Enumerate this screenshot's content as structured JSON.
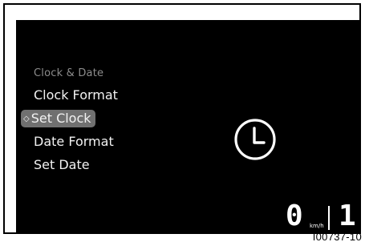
{
  "menu": {
    "header": "Clock & Date",
    "items": [
      {
        "label": "Clock Format",
        "selected": false
      },
      {
        "label": "Set Clock",
        "selected": true
      },
      {
        "label": "Date Format",
        "selected": false
      },
      {
        "label": "Set Date",
        "selected": false
      }
    ],
    "selection_marker": "◇"
  },
  "display": {
    "icon": "clock-icon",
    "speed": "0",
    "speed_unit": "km/h",
    "gear": "1"
  },
  "figure": {
    "ref_code": "I00737-10"
  },
  "colors": {
    "screen_bg": "#000000",
    "text": "#f2f2f2",
    "header_text": "#8c8c8c",
    "highlight_bg": "#707070"
  }
}
